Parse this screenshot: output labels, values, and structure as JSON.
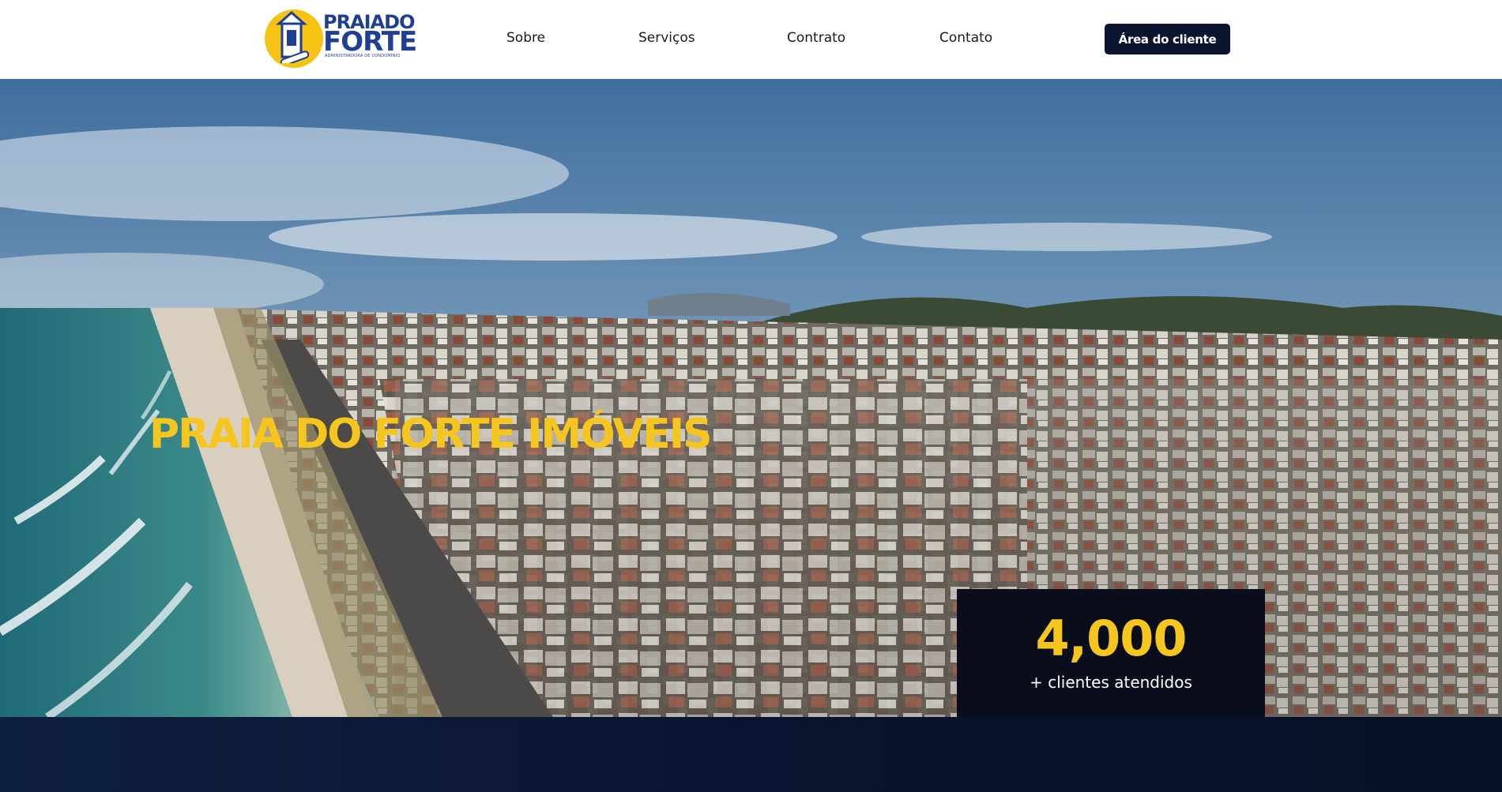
{
  "header": {
    "logo": {
      "line1": "PRAIADO",
      "line2": "FORTE",
      "line3": "ADMINISTRADORA DE CONDOMÍNIO"
    },
    "nav": [
      {
        "label": "Sobre"
      },
      {
        "label": "Serviços"
      },
      {
        "label": "Contrato"
      },
      {
        "label": "Contato"
      }
    ],
    "client_button": "Área do cliente"
  },
  "hero": {
    "title": "PRAIA DO FORTE IMÓVEIS",
    "stat": {
      "number": "4,000",
      "label": "+ clientes atendidos"
    }
  },
  "colors": {
    "accent_yellow": "#f6c61f",
    "navy": "#0b1530",
    "logo_blue": "#1f3f95"
  }
}
